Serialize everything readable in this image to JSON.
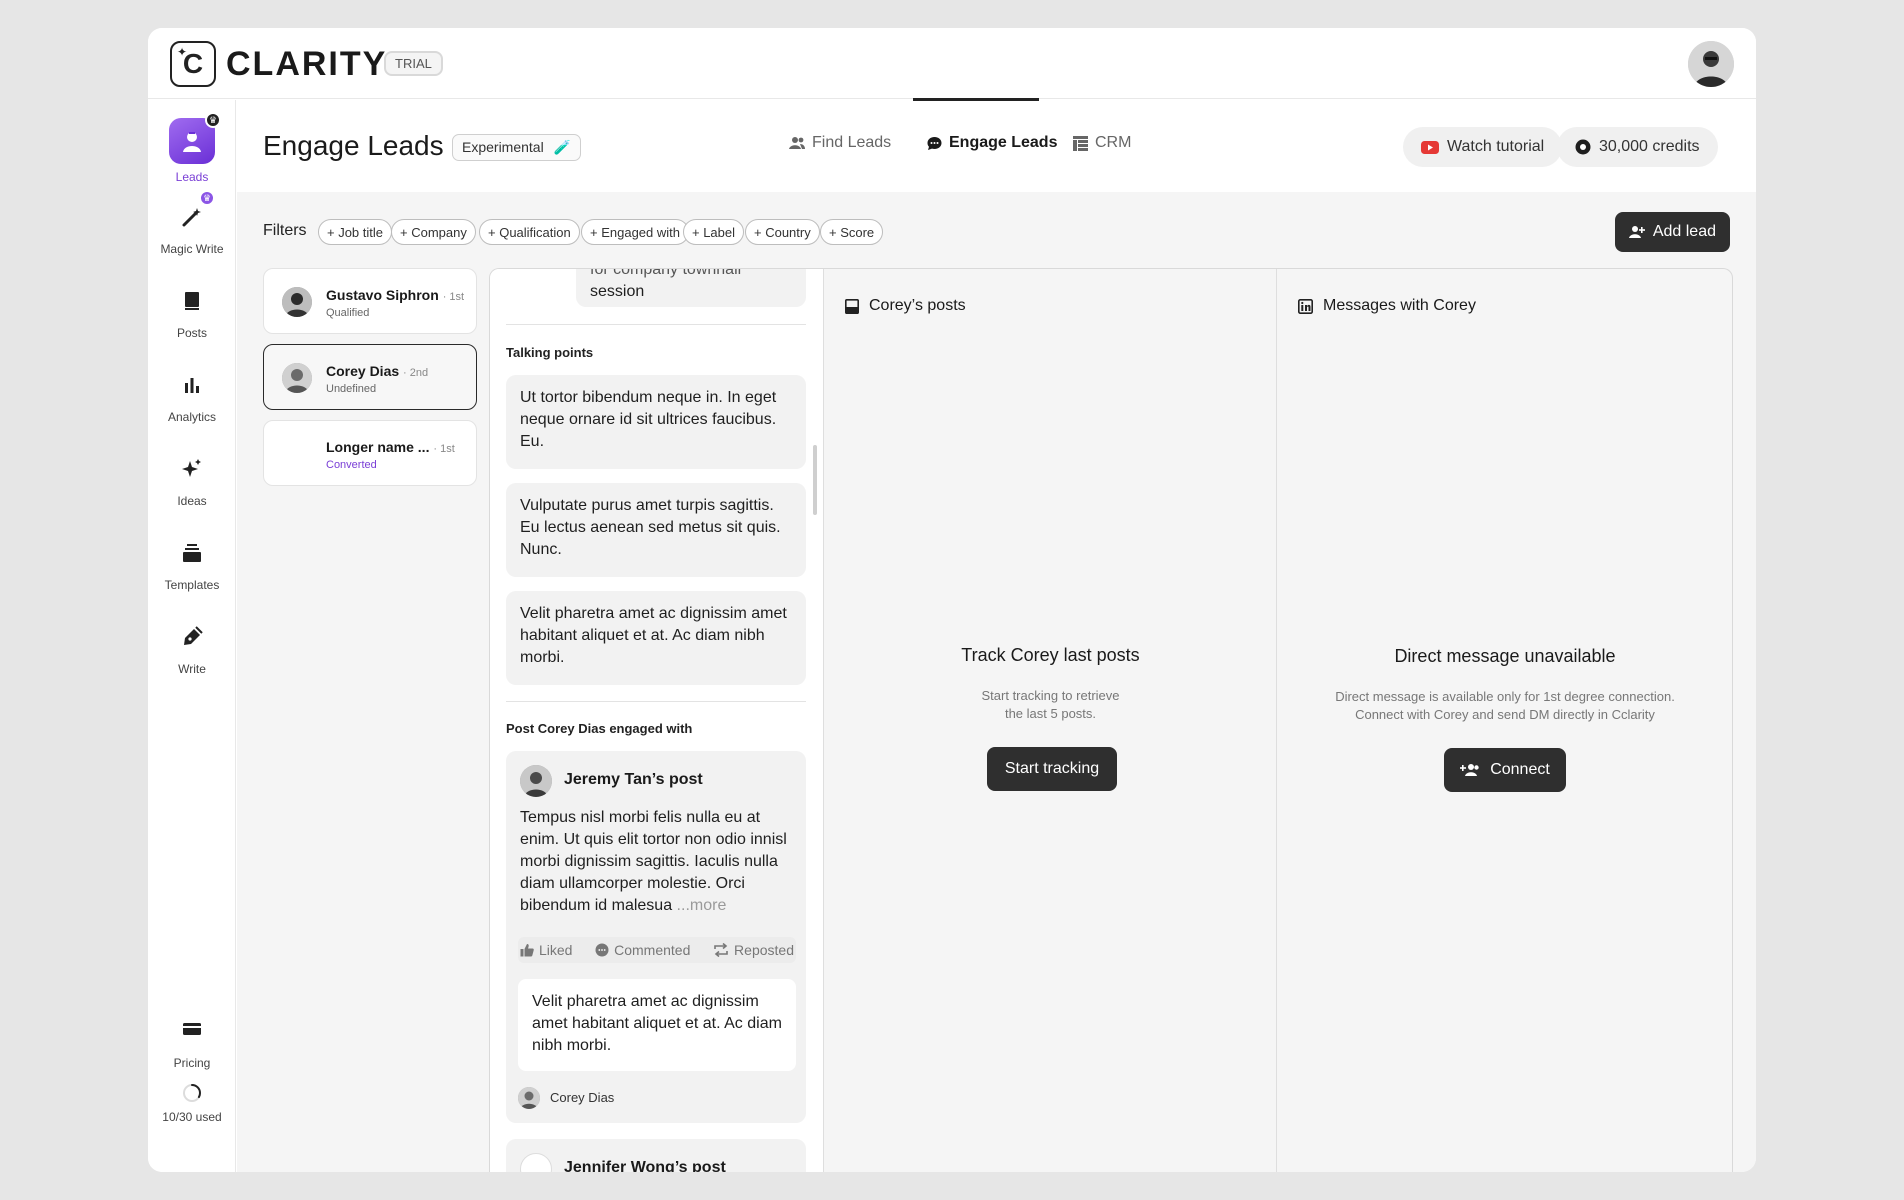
{
  "app": {
    "logo_text": "CLARITY",
    "logo_letter": "C",
    "trial_badge": "TRIAL"
  },
  "sidebar": {
    "items": [
      {
        "label": "Leads",
        "icon": "leads-icon"
      },
      {
        "label": "Magic Write",
        "icon": "magic-wand-icon"
      },
      {
        "label": "Posts",
        "icon": "posts-icon"
      },
      {
        "label": "Analytics",
        "icon": "analytics-icon"
      },
      {
        "label": "Ideas",
        "icon": "sparkle-icon"
      },
      {
        "label": "Templates",
        "icon": "templates-icon"
      },
      {
        "label": "Write",
        "icon": "pen-icon"
      }
    ],
    "pricing_label": "Pricing",
    "usage_label": "10/30 used",
    "usage_fraction": 0.333
  },
  "header": {
    "title": "Engage Leads",
    "badge": "Experimental",
    "tabs": [
      {
        "label": "Find Leads",
        "icon": "people-icon"
      },
      {
        "label": "Engage Leads",
        "icon": "chat-icon"
      },
      {
        "label": "CRM",
        "icon": "table-icon"
      }
    ],
    "watch_tutorial": "Watch tutorial",
    "credits": "30,000 credits"
  },
  "filters": {
    "label": "Filters",
    "chips": [
      "+ Job title",
      "+ Company",
      "+ Qualification",
      "+ Engaged with",
      "+ Label",
      "+ Country",
      "+ Score"
    ],
    "add_lead": "Add lead"
  },
  "leads": [
    {
      "name": "Gustavo Siphron",
      "degree": "· 1st",
      "status": "Qualified"
    },
    {
      "name": "Corey Dias",
      "degree": "· 2nd",
      "status": "Undefined"
    },
    {
      "name": "Longer name ...",
      "degree": "· 1st",
      "status": "Converted"
    }
  ],
  "detail": {
    "top_snippet_line1": "for company townhall",
    "top_snippet_line2": "session",
    "talking_points_title": "Talking points",
    "talking_points": [
      "Ut tortor bibendum neque in. In eget neque ornare id sit ultrices faucibus. Eu.",
      "Vulputate purus amet turpis sagittis. Eu lectus aenean sed metus sit quis. Nunc.",
      "Velit pharetra amet ac dignissim amet habitant aliquet et at. Ac diam nibh morbi."
    ],
    "engaged_title": "Post Corey Dias engaged with",
    "post": {
      "author": "Jeremy Tan’s post",
      "body": "Tempus nisl morbi felis nulla eu at enim. Ut quis elit tortor non odio innisl morbi dignissim sagittis. Iaculis nulla diam ullamcorper molestie. Orci bibendum id malesua",
      "more": "...more",
      "liked": "Liked",
      "commented": "Commented",
      "reposted": "Reposted",
      "reply": "Velit pharetra amet ac dignissim amet habitant aliquet et at. Ac diam nibh morbi.",
      "reply_author": "Corey Dias"
    },
    "post2_author": "Jennifer Wong’s post"
  },
  "posts_col": {
    "title": "Corey’s posts",
    "empty_title": "Track Corey last posts",
    "empty_sub_line1": "Start tracking to retrieve",
    "empty_sub_line2": "the last 5 posts.",
    "button": "Start tracking"
  },
  "messages_col": {
    "title": "Messages with Corey",
    "empty_title": "Direct message unavailable",
    "empty_sub_line1": "Direct message is available only for 1st degree connection.",
    "empty_sub_line2": "Connect with Corey and send DM directly in Cclarity",
    "button": "Connect"
  },
  "colors": {
    "accent": "#7a3fd6",
    "dark_button": "#2f2f2f",
    "youtube_red": "#e53935"
  }
}
